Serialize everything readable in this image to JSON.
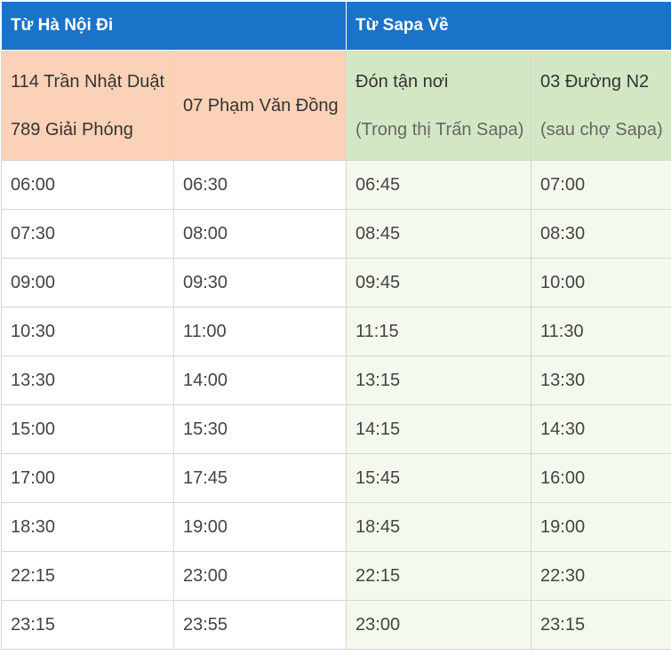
{
  "header": {
    "from_hanoi": "Từ Hà Nội Đi",
    "from_sapa": "Từ Sapa Về"
  },
  "subheader": {
    "col1_line1": "114 Trần Nhật Duật",
    "col1_line2": "789 Giải Phóng",
    "col2": "07 Phạm Văn Đồng",
    "col3_line1": "Đón tận nơi",
    "col3_line2": "(Trong thị Trấn Sapa)",
    "col4_line1": "03 Đường N2",
    "col4_line2": "(sau chợ Sapa)"
  },
  "colors": {
    "header_blue": "#1a73c9",
    "hanoi_sub_bg": "#fbd2b7",
    "sapa_sub_bg": "#d4e7c5",
    "sapa_rows_bg": "#f4f9ee"
  },
  "rows": [
    [
      "06:00",
      "06:30",
      "06:45",
      "07:00"
    ],
    [
      "07:30",
      "08:00",
      "08:45",
      "08:30"
    ],
    [
      "09:00",
      "09:30",
      "09:45",
      "10:00"
    ],
    [
      "10:30",
      "11:00",
      "11:15",
      "11:30"
    ],
    [
      "13:30",
      "14:00",
      "13:15",
      "13:30"
    ],
    [
      "15:00",
      "15:30",
      "14:15",
      "14:30"
    ],
    [
      "17:00",
      "17:45",
      "15:45",
      "16:00"
    ],
    [
      "18:30",
      "19:00",
      "18:45",
      "19:00"
    ],
    [
      "22:15",
      "23:00",
      "22:15",
      "22:30"
    ],
    [
      "23:15",
      "23:55",
      "23:00",
      "23:15"
    ]
  ]
}
